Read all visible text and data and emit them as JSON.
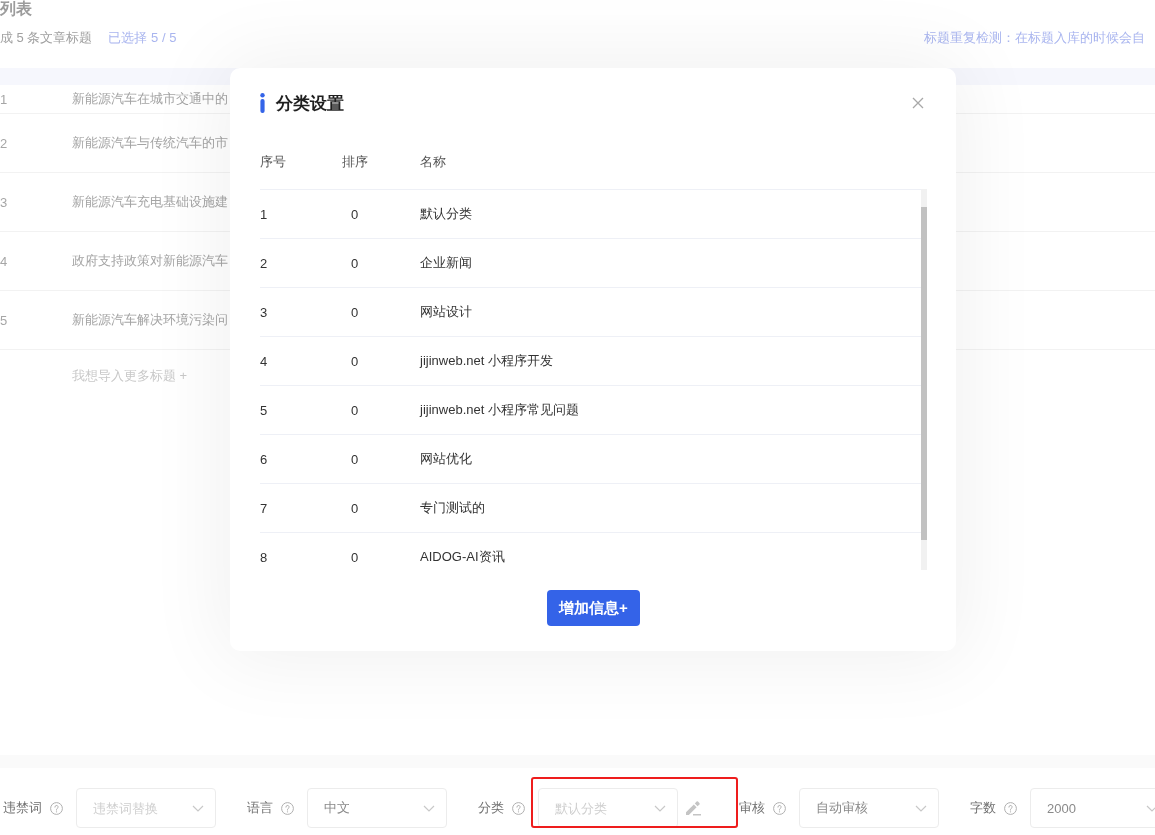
{
  "page": {
    "title": "列表",
    "summary": "成 5 条文章标题",
    "selection": "已选择 5 / 5",
    "notice": "标题重复检测：在标题入库的时候会自"
  },
  "title_list": {
    "rows": [
      {
        "number": "1",
        "title": "新能源汽车在城市交通中的"
      },
      {
        "number": "2",
        "title": "新能源汽车与传统汽车的市"
      },
      {
        "number": "3",
        "title": "新能源汽车充电基础设施建"
      },
      {
        "number": "4",
        "title": "政府支持政策对新能源汽车"
      },
      {
        "number": "5",
        "title": "新能源汽车解决环境污染问"
      }
    ],
    "add_more": "我想导入更多标题 +"
  },
  "settings_bar": {
    "fields": [
      {
        "label": "违禁词",
        "placeholder": "违禁词替换",
        "edit_button": false,
        "highlighted": false
      },
      {
        "label": "语言",
        "value": "中文",
        "edit_button": false,
        "highlighted": false
      },
      {
        "label": "分类",
        "placeholder": "默认分类",
        "edit_button": true,
        "highlighted": true
      },
      {
        "label": "审核",
        "value": "自动审核",
        "edit_button": false,
        "highlighted": false
      },
      {
        "label": "字数",
        "value": "2000",
        "edit_button": false,
        "highlighted": false
      }
    ]
  },
  "dialog": {
    "title": "分类设置",
    "columns": [
      "序号",
      "排序",
      "名称"
    ],
    "rows": [
      {
        "index": "1",
        "sort": "0",
        "name": "默认分类"
      },
      {
        "index": "2",
        "sort": "0",
        "name": "企业新闻"
      },
      {
        "index": "3",
        "sort": "0",
        "name": "网站设计"
      },
      {
        "index": "4",
        "sort": "0",
        "name": "jijinweb.net 小程序开发"
      },
      {
        "index": "5",
        "sort": "0",
        "name": "jijinweb.net 小程序常见问题"
      },
      {
        "index": "6",
        "sort": "0",
        "name": "网站优化"
      },
      {
        "index": "7",
        "sort": "0",
        "name": "专门测试的"
      },
      {
        "index": "8",
        "sort": "0",
        "name": "AIDOG-AI资讯"
      }
    ],
    "add_button": "增加信息+"
  }
}
